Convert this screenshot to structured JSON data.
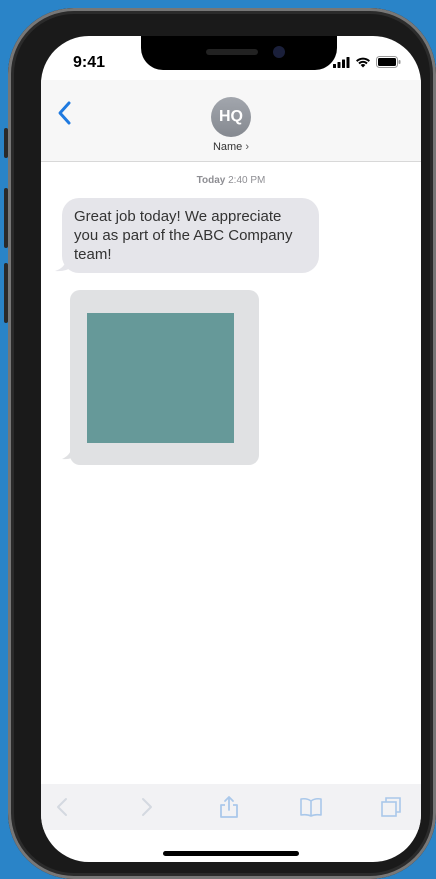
{
  "status_bar": {
    "time": "9:41"
  },
  "header": {
    "avatar_initials": "HQ",
    "contact_name": "Name",
    "chevron": "›"
  },
  "messages": {
    "timestamp_day": "Today",
    "timestamp_time": "2:40 PM",
    "incoming_text": "Great job today! We appreciate you as part of the ABC Company team!"
  },
  "toolbar": {
    "icons": [
      "back-arrow-icon",
      "forward-arrow-icon",
      "share-icon",
      "bookmarks-icon",
      "tabs-icon"
    ]
  },
  "colors": {
    "accent": "#1f7ae0",
    "background": "#2a84c8",
    "bubble_gray": "#e5e5ea",
    "image_placeholder": "#669999"
  }
}
